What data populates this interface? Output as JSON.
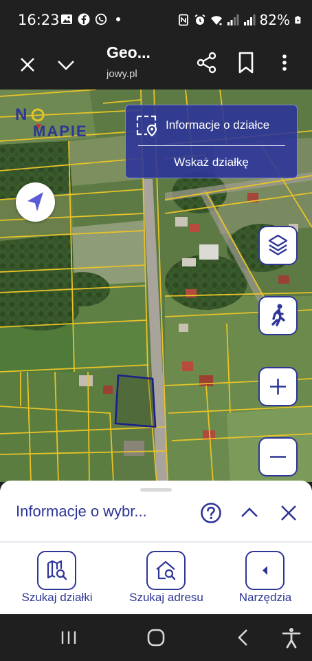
{
  "status_bar": {
    "time": "16:23",
    "battery_percent": "82%",
    "icons_left": [
      "image-icon",
      "facebook-icon",
      "whatsapp-icon",
      "dot-icon"
    ],
    "icons_right": [
      "nfc-icon",
      "alarm-icon",
      "wifi-icon",
      "signal-icon",
      "signal-icon",
      "battery-charging-icon"
    ]
  },
  "browser": {
    "title": "Geo...",
    "url": "jowy.pl",
    "icons": [
      "close-icon",
      "chevron-down-icon",
      "share-icon",
      "bookmark-icon",
      "more-vert-icon"
    ]
  },
  "map": {
    "logo": "NA MAPIE",
    "info_panel": {
      "parcel_info_label": "Informacje o działce",
      "show_parcel_label": "Wskaż działkę"
    },
    "controls": [
      "layers-icon",
      "person-walk-icon",
      "zoom-in-icon",
      "zoom-out-icon"
    ],
    "accent_color": "#2d3596",
    "parcel_outline_color": "#1a1f8a",
    "boundary_color": "#e8c328"
  },
  "sheet": {
    "title": "Informacje o wybr...",
    "tools": [
      {
        "label": "Szukaj działki"
      },
      {
        "label": "Szukaj adresu"
      },
      {
        "label": "Narzędzia"
      }
    ]
  },
  "navbar": {
    "icons": [
      "recent-apps-icon",
      "home-icon",
      "back-icon",
      "accessibility-icon"
    ]
  }
}
